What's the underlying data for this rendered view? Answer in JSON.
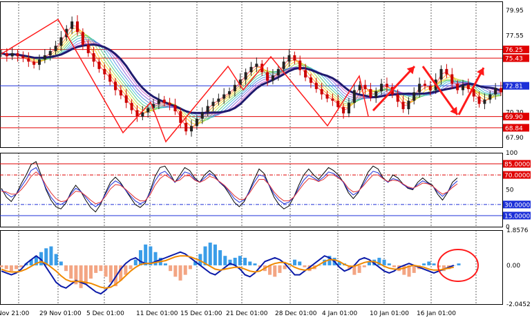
{
  "chart_data": [
    {
      "type": "candlestick",
      "panel": "price",
      "y_ticks": [
        "79.95",
        "77.55",
        "75.43",
        "72.81",
        "70.30",
        "67.90"
      ],
      "ylim": [
        67.0,
        80.8
      ],
      "horizontal_levels": [
        {
          "value": 76.25,
          "label": "76.25",
          "color": "#e00000",
          "tag": true
        },
        {
          "value": 75.43,
          "label": "75.43",
          "color": "#e00000",
          "tag": true
        },
        {
          "value": 72.81,
          "label": "72.81",
          "color": "#1c2fd8",
          "tag": true
        },
        {
          "value": 69.9,
          "label": "69.90",
          "color": "#e00000",
          "tag": true
        },
        {
          "value": 68.84,
          "label": "68.84",
          "color": "#e00000",
          "tag": true
        }
      ],
      "close_series": [
        75.9,
        75.6,
        75.9,
        75.6,
        75.4,
        75.1,
        74.8,
        75.3,
        75.7,
        76.1,
        76.6,
        77.4,
        78.2,
        78.9,
        77.9,
        76.7,
        75.9,
        75.1,
        74.4,
        73.9,
        73.2,
        72.4,
        71.9,
        71.2,
        70.5,
        69.9,
        70.3,
        70.7,
        71.1,
        71.5,
        71.2,
        71.0,
        70.4,
        69.3,
        68.5,
        69.0,
        69.7,
        70.3,
        70.9,
        71.3,
        71.6,
        72.0,
        72.3,
        72.9,
        73.4,
        74.1,
        74.6,
        74.9,
        74.1,
        73.3,
        73.8,
        74.4,
        75.1,
        75.7,
        75.2,
        74.3,
        73.6,
        73.1,
        72.5,
        72.0,
        71.6,
        71.4,
        70.8,
        70.2,
        71.2,
        72.4,
        72.9,
        72.5,
        71.7,
        72.3,
        73.0,
        72.7,
        72.0,
        71.3,
        70.6,
        71.4,
        72.2,
        73.0,
        72.8,
        72.4,
        73.4,
        74.4,
        73.9,
        73.0,
        72.4,
        72.9,
        72.5,
        71.8,
        71.1,
        71.5,
        72.0,
        72.6,
        72.2
      ]
    },
    {
      "type": "line",
      "panel": "stochastic",
      "y_ticks": [
        "100",
        "85.0000",
        "70.0000",
        "50",
        "30.0000",
        "15.0000",
        "0"
      ],
      "ylim": [
        0,
        100
      ],
      "levels": [
        {
          "value": 85,
          "label": "85.0000",
          "color": "#e00000"
        },
        {
          "value": 70,
          "label": "70.0000",
          "color": "#e00000"
        },
        {
          "value": 30,
          "label": "30.0000",
          "color": "#1c2fd8"
        },
        {
          "value": 15,
          "label": "15.0000",
          "color": "#1c2fd8"
        }
      ],
      "series": [
        {
          "color": "#000000",
          "values": [
            52,
            40,
            34,
            44,
            58,
            70,
            84,
            88,
            70,
            50,
            36,
            27,
            24,
            32,
            46,
            56,
            48,
            36,
            26,
            20,
            30,
            46,
            60,
            67,
            60,
            50,
            40,
            30,
            26,
            32,
            48,
            68,
            80,
            82,
            72,
            60,
            70,
            80,
            76,
            66,
            60,
            70,
            76,
            70,
            60,
            54,
            44,
            33,
            27,
            34,
            48,
            64,
            78,
            72,
            56,
            40,
            30,
            24,
            28,
            40,
            56,
            70,
            78,
            70,
            64,
            72,
            80,
            76,
            70,
            60,
            46,
            38,
            46,
            60,
            74,
            82,
            78,
            66,
            60,
            70,
            66,
            58,
            52,
            50,
            60,
            66,
            60,
            56,
            44,
            36,
            46,
            60,
            66
          ]
        },
        {
          "color": "#1c2fd8",
          "values": [
            50,
            45,
            40,
            44,
            54,
            64,
            76,
            80,
            68,
            52,
            40,
            32,
            30,
            34,
            44,
            52,
            48,
            40,
            32,
            27,
            32,
            44,
            56,
            62,
            58,
            50,
            42,
            35,
            31,
            34,
            46,
            62,
            72,
            75,
            68,
            60,
            66,
            74,
            72,
            64,
            60,
            66,
            72,
            68,
            60,
            55,
            47,
            38,
            33,
            36,
            47,
            60,
            70,
            68,
            56,
            44,
            36,
            31,
            33,
            40,
            52,
            63,
            70,
            66,
            62,
            67,
            74,
            72,
            67,
            60,
            49,
            43,
            47,
            57,
            68,
            75,
            73,
            65,
            60,
            65,
            63,
            57,
            53,
            51,
            57,
            62,
            59,
            55,
            47,
            41,
            47,
            56,
            62
          ]
        },
        {
          "color": "#e03030",
          "values": [
            48,
            47,
            44,
            44,
            50,
            58,
            68,
            74,
            68,
            56,
            46,
            38,
            34,
            35,
            42,
            48,
            47,
            42,
            36,
            31,
            33,
            41,
            51,
            57,
            56,
            51,
            45,
            39,
            35,
            35,
            43,
            56,
            65,
            70,
            66,
            61,
            63,
            69,
            69,
            63,
            60,
            63,
            68,
            66,
            61,
            56,
            49,
            42,
            37,
            37,
            45,
            55,
            64,
            64,
            57,
            47,
            40,
            35,
            35,
            40,
            49,
            58,
            65,
            64,
            61,
            64,
            70,
            70,
            66,
            61,
            52,
            47,
            48,
            55,
            63,
            70,
            70,
            65,
            61,
            63,
            62,
            58,
            54,
            52,
            55,
            59,
            58,
            55,
            49,
            44,
            47,
            53,
            58
          ]
        }
      ]
    },
    {
      "type": "bar",
      "panel": "macd",
      "y_ticks": [
        "1.8576",
        "0.00",
        "-2.0452"
      ],
      "ylim": [
        -2.0452,
        1.8576
      ],
      "histogram": [
        -0.1,
        -0.2,
        -0.3,
        -0.2,
        -0.1,
        0.1,
        0.3,
        0.5,
        0.7,
        0.9,
        1.0,
        0.6,
        0.2,
        -0.3,
        -0.7,
        -1.0,
        -1.2,
        -1.0,
        -0.7,
        -0.4,
        -0.3,
        -0.6,
        -0.9,
        -1.1,
        -0.8,
        -0.5,
        -0.2,
        0.3,
        0.8,
        1.1,
        1.0,
        0.7,
        0.4,
        0.1,
        -0.3,
        -0.6,
        -0.8,
        -0.5,
        -0.2,
        0.2,
        0.6,
        1.0,
        1.2,
        1.1,
        0.8,
        0.5,
        0.3,
        0.4,
        0.5,
        0.4,
        0.2,
        0.1,
        -0.1,
        -0.3,
        -0.5,
        -0.6,
        -0.4,
        -0.2,
        0.1,
        0.3,
        0.2,
        -0.1,
        -0.3,
        -0.2,
        0.0,
        0.3,
        0.5,
        0.4,
        0.2,
        0.1,
        -0.2,
        -0.5,
        -0.4,
        -0.1,
        0.2,
        0.3,
        0.4,
        0.3,
        0.1,
        -0.1,
        -0.3,
        -0.5,
        -0.6,
        -0.4,
        -0.2,
        0.1,
        0.2,
        0.1,
        -0.1,
        -0.3,
        -0.2,
        0.0,
        0.1
      ],
      "series": [
        {
          "color": "#0b1aa8",
          "values": [
            -0.3,
            -0.4,
            -0.5,
            -0.4,
            -0.2,
            0.1,
            0.3,
            0.5,
            0.3,
            -0.1,
            -0.5,
            -0.9,
            -1.1,
            -1.2,
            -1.0,
            -0.8,
            -0.9,
            -1.0,
            -1.2,
            -1.4,
            -1.5,
            -1.3,
            -1.0,
            -0.6,
            -0.2,
            0.1,
            0.3,
            0.4,
            0.2,
            0.1,
            0.1,
            0.2,
            0.3,
            0.4,
            0.5,
            0.6,
            0.7,
            0.6,
            0.4,
            0.2,
            0.0,
            -0.2,
            -0.4,
            -0.5,
            -0.3,
            -0.1,
            0.1,
            0.0,
            -0.2,
            -0.5,
            -0.6,
            -0.4,
            -0.1,
            0.2,
            0.3,
            0.4,
            0.3,
            0.1,
            -0.2,
            -0.5,
            -0.5,
            -0.3,
            -0.1,
            0.1,
            0.3,
            0.5,
            0.4,
            0.2,
            -0.1,
            -0.3,
            -0.2,
            0.0,
            0.3,
            0.4,
            0.3,
            0.1,
            -0.1,
            -0.3,
            -0.4,
            -0.3,
            -0.1,
            0.0,
            0.1,
            0.0,
            -0.1,
            -0.2,
            -0.3,
            -0.4,
            -0.3,
            -0.2,
            -0.1,
            0.0
          ]
        },
        {
          "color": "#f08a00",
          "values": [
            -0.2,
            -0.3,
            -0.35,
            -0.35,
            -0.3,
            -0.2,
            -0.05,
            0.1,
            0.2,
            0.1,
            -0.1,
            -0.3,
            -0.55,
            -0.75,
            -0.85,
            -0.85,
            -0.85,
            -0.9,
            -0.95,
            -1.05,
            -1.15,
            -1.2,
            -1.15,
            -1.0,
            -0.8,
            -0.55,
            -0.3,
            -0.1,
            0.05,
            0.1,
            0.1,
            0.15,
            0.2,
            0.25,
            0.35,
            0.45,
            0.5,
            0.5,
            0.45,
            0.35,
            0.25,
            0.1,
            -0.05,
            -0.2,
            -0.25,
            -0.2,
            -0.15,
            -0.1,
            -0.1,
            -0.2,
            -0.3,
            -0.35,
            -0.3,
            -0.15,
            0.0,
            0.1,
            0.15,
            0.15,
            0.05,
            -0.1,
            -0.2,
            -0.25,
            -0.2,
            -0.1,
            0.05,
            0.2,
            0.3,
            0.3,
            0.2,
            0.05,
            -0.05,
            -0.05,
            0.05,
            0.15,
            0.2,
            0.2,
            0.1,
            -0.05,
            -0.15,
            -0.2,
            -0.2,
            -0.15,
            -0.05,
            0.0,
            -0.05,
            -0.1,
            -0.2,
            -0.25,
            -0.25,
            -0.2,
            -0.15,
            -0.1
          ]
        }
      ]
    }
  ],
  "x_labels": [
    "Nov 21:00",
    "29 Nov 01:00",
    "5 Dec 01:00",
    "11 Dec 01:00",
    "15 Dec 01:00",
    "21 Dec 01:00",
    "28 Dec 01:00",
    "4 Jan 01:00",
    "10 Jan 01:00",
    "16 Jan 01:00"
  ],
  "colors": {
    "grid": "#000000",
    "bull_candle": "#222222",
    "bear_candle": "#cc0000",
    "ma_main": "#1f1a6e",
    "annotation": "#ff1a1a",
    "hist_pos": "#3a9de8",
    "hist_neg": "#f3a583"
  }
}
